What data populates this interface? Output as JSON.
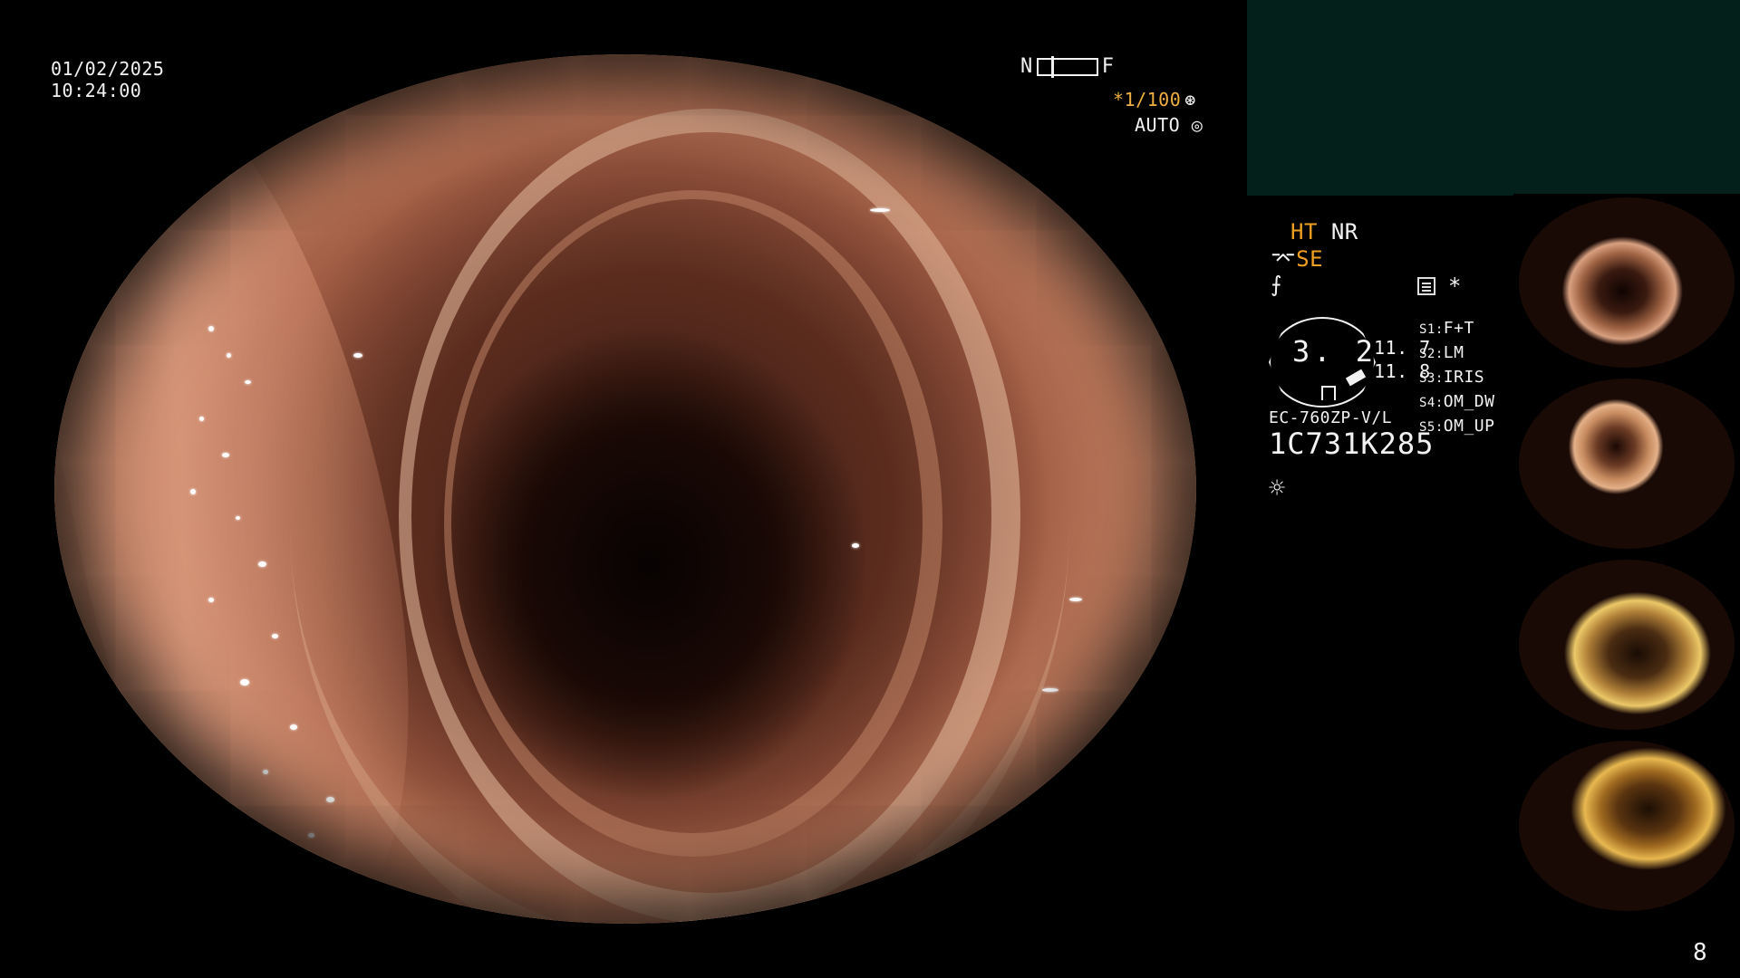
{
  "overlay": {
    "date": "01/02/2025",
    "time": "10:24:00",
    "nf_near": "N",
    "nf_far": "F",
    "shutter_star": "*",
    "shutter": "1/100",
    "shutter_icon": "aperture-icon",
    "auto_label": "AUTO",
    "auto_icon": "iris-icon"
  },
  "settings": {
    "ht": "HT",
    "nr": "NR",
    "se_icon": "scope-icon",
    "se": "SE",
    "wave_icon": "wave-icon",
    "menu_icon": "list-icon",
    "star": "*"
  },
  "scope": {
    "dial_value": "3. 2",
    "value_a": "11. 7",
    "value_b": "11. 8",
    "model": "EC-760ZP-V/L",
    "serial": "1C731K285",
    "light_icon": "sun-icon"
  },
  "switches": [
    {
      "key": "S1:",
      "value": "F+T"
    },
    {
      "key": "S2:",
      "value": "LM"
    },
    {
      "key": "S3:",
      "value": "IRIS"
    },
    {
      "key": "S4:",
      "value": "OM_DW"
    },
    {
      "key": "S5:",
      "value": "OM_UP"
    }
  ],
  "thumbnails": [
    {
      "name": "captured-image-1",
      "color": "#c98a64"
    },
    {
      "name": "captured-image-2",
      "color": "#d49870"
    },
    {
      "name": "captured-image-3",
      "color": "#c9a050"
    },
    {
      "name": "captured-image-4",
      "color": "#a87a30"
    }
  ],
  "page_number": "8",
  "colors": {
    "accent": "#f0a020",
    "panel": "#03201a"
  }
}
